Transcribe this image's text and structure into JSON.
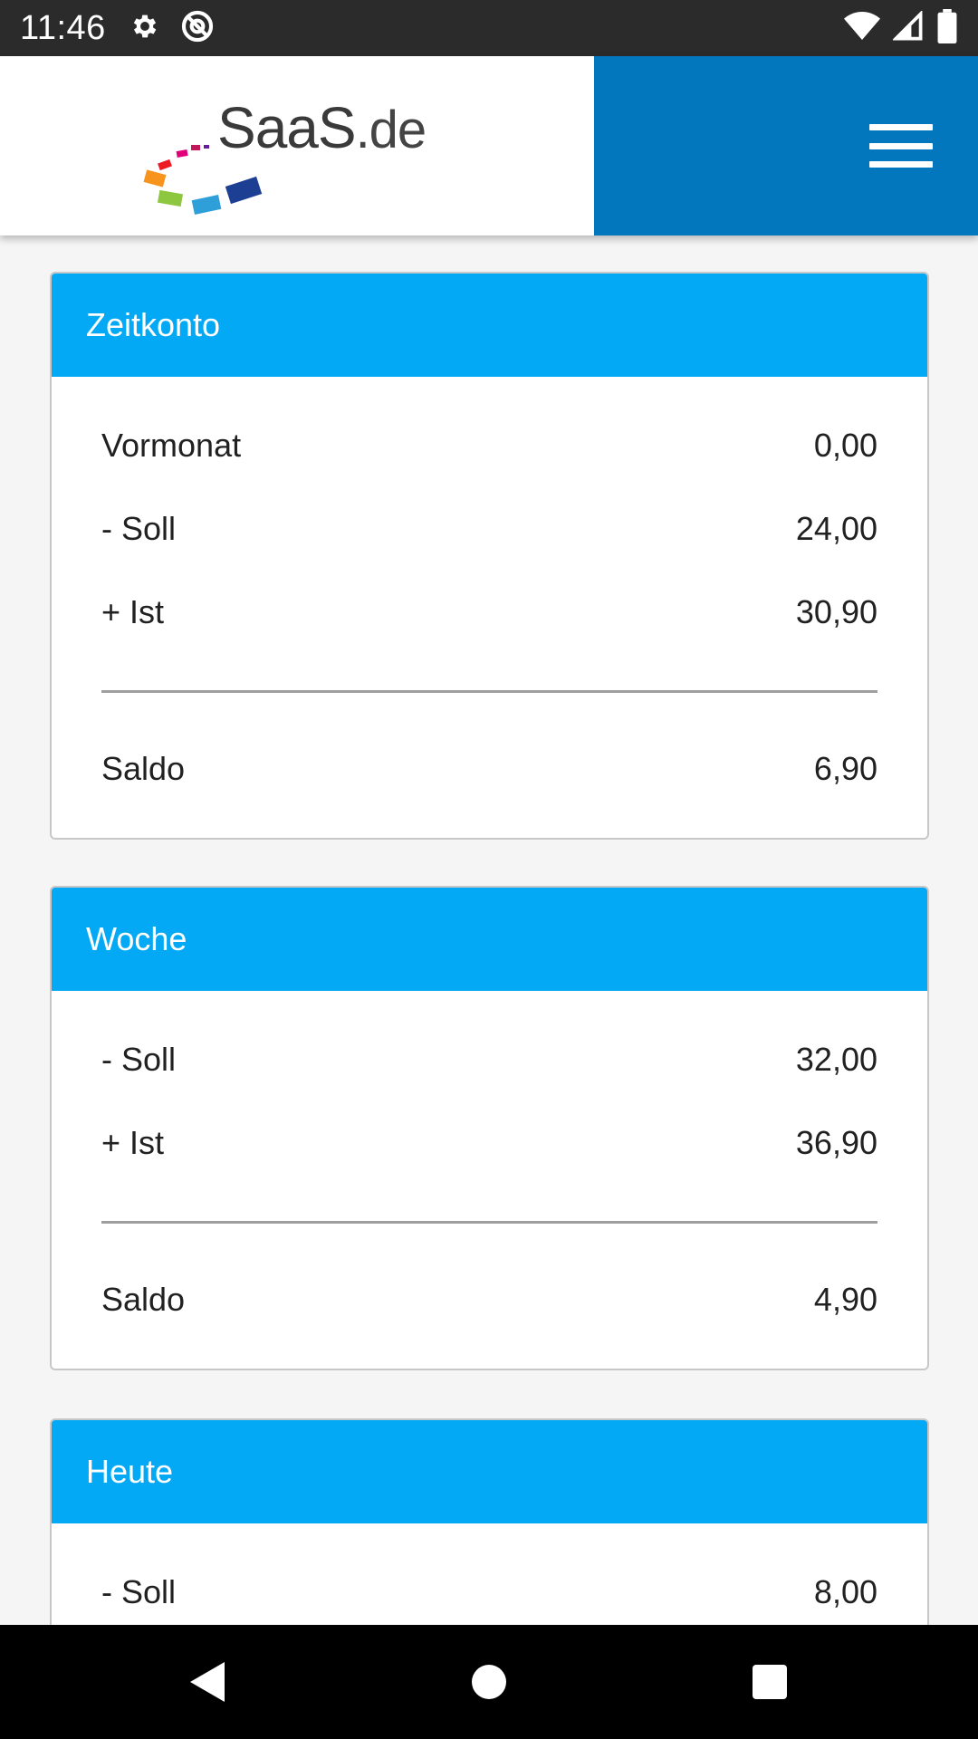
{
  "status_bar": {
    "time": "11:46",
    "left_icons": [
      "gear-icon",
      "at-sign-icon"
    ],
    "right_icons": [
      "wifi-icon",
      "cell-signal-icon",
      "battery-icon"
    ]
  },
  "header": {
    "logo_text": "SaaS",
    "logo_suffix": ".de",
    "menu_icon": "hamburger-menu-icon",
    "accent_color": "#0277bd"
  },
  "cards": [
    {
      "title": "Zeitkonto",
      "rows_top": [
        {
          "label": "Vormonat",
          "value": "0,00"
        },
        {
          "label": "- Soll",
          "value": "24,00"
        },
        {
          "label": "+ Ist",
          "value": "30,90"
        }
      ],
      "total": {
        "label": "Saldo",
        "value": "6,90"
      }
    },
    {
      "title": "Woche",
      "rows_top": [
        {
          "label": "- Soll",
          "value": "32,00"
        },
        {
          "label": "+ Ist",
          "value": "36,90"
        }
      ],
      "total": {
        "label": "Saldo",
        "value": "4,90"
      }
    },
    {
      "title": "Heute",
      "rows_top": [
        {
          "label": "- Soll",
          "value": "8,00"
        }
      ]
    }
  ],
  "colors": {
    "card_header": "#03a9f4",
    "status_bar": "#2b2b2b",
    "nav_bar": "#000000"
  },
  "nav_bar": {
    "icons": [
      "back-icon",
      "home-icon",
      "recents-icon"
    ]
  }
}
